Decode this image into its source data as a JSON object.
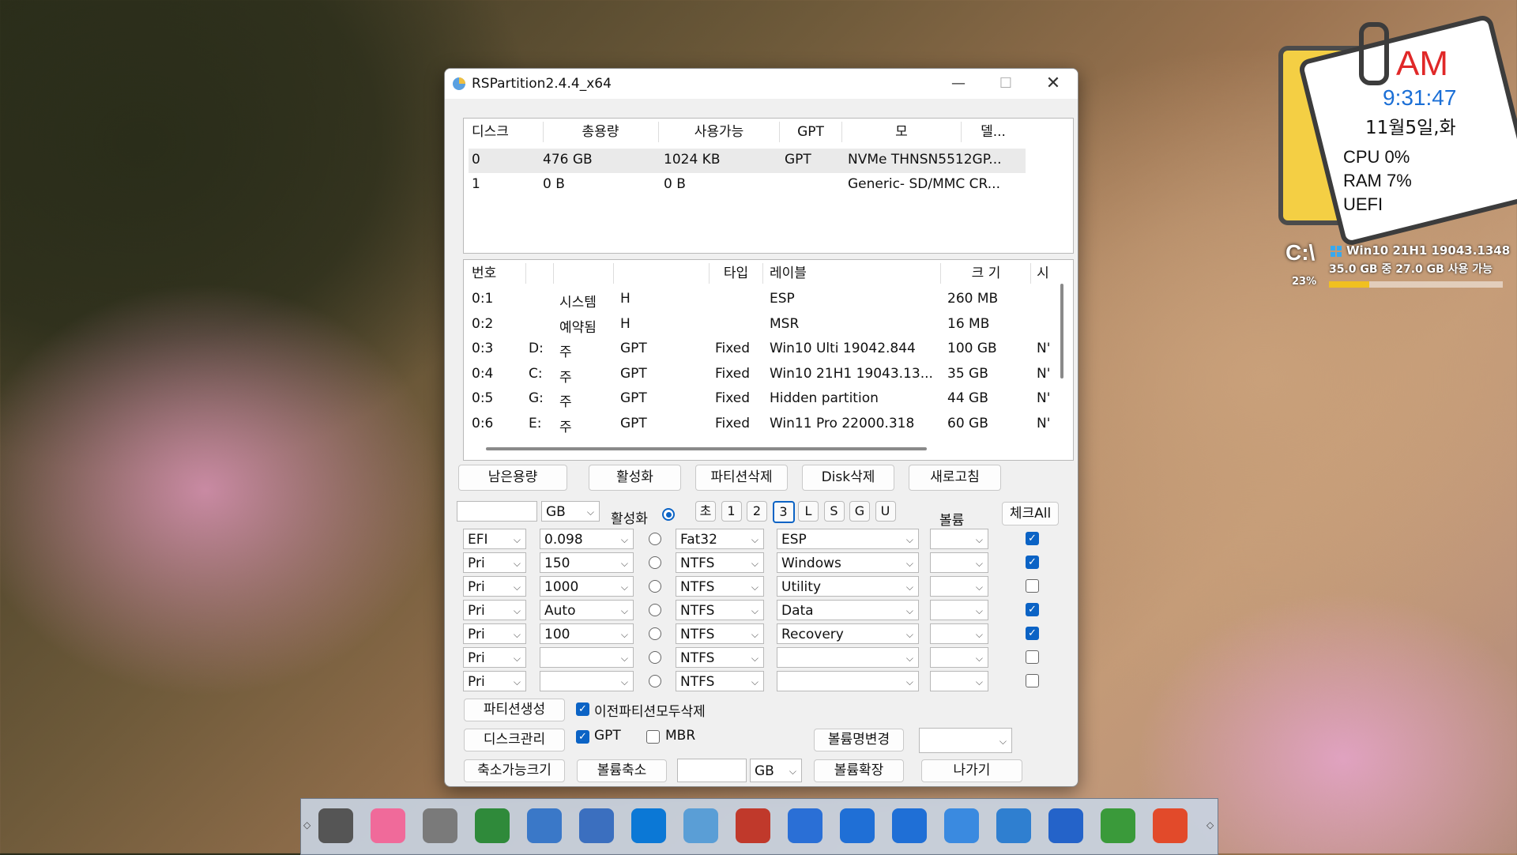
{
  "window": {
    "title": "RSPartition2.4.4_x64",
    "min": "—",
    "max": "☐",
    "close": "✕"
  },
  "disks": {
    "headers": [
      "디스크",
      "총용량",
      "사용가능",
      "GPT",
      "모",
      "델..."
    ],
    "rows": [
      [
        "0",
        "476 GB",
        "1024 KB",
        "GPT",
        "NVMe THNSN5512GP..."
      ],
      [
        "1",
        "0 B",
        "0 B",
        "",
        "Generic- SD/MMC CR..."
      ]
    ]
  },
  "partitions": {
    "headers": [
      "번호",
      "",
      "",
      "",
      "타입",
      "레이블",
      "크 기",
      "시"
    ],
    "rows": [
      [
        "0:1",
        "",
        "시스템",
        "H",
        "",
        "ESP",
        "260 MB",
        ""
      ],
      [
        "0:2",
        "",
        "예약됨",
        "H",
        "",
        "MSR",
        "16 MB",
        ""
      ],
      [
        "0:3",
        "D:",
        "주",
        "GPT",
        "Fixed",
        "Win10 Ulti 19042.844",
        "100 GB",
        "N'"
      ],
      [
        "0:4",
        "C:",
        "주",
        "GPT",
        "Fixed",
        "Win10 21H1 19043.13...",
        "35 GB",
        "N'"
      ],
      [
        "0:5",
        "G:",
        "주",
        "GPT",
        "Fixed",
        "Hidden partition",
        "44 GB",
        "N'"
      ],
      [
        "0:6",
        "E:",
        "주",
        "GPT",
        "Fixed",
        "Win11 Pro 22000.318",
        "60 GB",
        "N'"
      ]
    ]
  },
  "action_buttons": [
    "남은용량",
    "활성화",
    "파티션삭제",
    "Disk삭제",
    "새로고침"
  ],
  "form": {
    "size_value": "",
    "unit": "GB",
    "active_label": "활성화",
    "pills": [
      "초",
      "1",
      "2",
      "3",
      "L",
      "S",
      "G",
      "U"
    ],
    "selected_pill": "3",
    "volume_label": "볼륨",
    "check_all": "체크All",
    "rows": [
      {
        "type": "EFI",
        "size": "0.098",
        "fs": "Fat32",
        "label": "ESP",
        "checked": true
      },
      {
        "type": "Pri",
        "size": "150",
        "fs": "NTFS",
        "label": "Windows",
        "checked": true
      },
      {
        "type": "Pri",
        "size": "1000",
        "fs": "NTFS",
        "label": "Utility",
        "checked": false
      },
      {
        "type": "Pri",
        "size": "Auto",
        "fs": "NTFS",
        "label": "Data",
        "checked": true
      },
      {
        "type": "Pri",
        "size": "100",
        "fs": "NTFS",
        "label": "Recovery",
        "checked": true
      },
      {
        "type": "Pri",
        "size": "",
        "fs": "NTFS",
        "label": "",
        "checked": false
      },
      {
        "type": "Pri",
        "size": "",
        "fs": "NTFS",
        "label": "",
        "checked": false
      }
    ]
  },
  "bottom": {
    "create": "파티션생성",
    "delete_all": "이전파티션모두삭제",
    "disk_mgmt": "디스크관리",
    "gpt": "GPT",
    "mbr": "MBR",
    "rename_volume": "볼륨명변경",
    "shrinkable": "축소가능크기",
    "shrink": "볼륨축소",
    "shrink_unit": "GB",
    "extend": "볼륨확장",
    "exit": "나가기"
  },
  "widget": {
    "ampm": "AM",
    "time": "9:31:47",
    "date": "11월5일,화",
    "cpu": "CPU  0%",
    "ram": "RAM  7%",
    "boot": "UEFI",
    "drive": "C:\\",
    "drive_pct": "23%",
    "drive_name": "Win10 21H1 19043.1348",
    "drive_free": "35.0 GB 중  27.0 GB 사용 가능",
    "drive_used_fraction": 0.23
  },
  "taskbar": {
    "icons": [
      "disk-tool-icon",
      "windows-pink-icon",
      "drive-tool-icon",
      "partition-icon",
      "search-tool-icon",
      "grid-icon",
      "windows-blue-icon",
      "file-icon",
      "toolbox-icon",
      "media-gear-icon",
      "windows-7-icon",
      "windows-7-alt-icon",
      "camera-icon",
      "explorer-icon",
      "windows-xp-icon",
      "update-icon",
      "power-icon"
    ],
    "colors": [
      "#555555",
      "#f06a9a",
      "#7a7a7a",
      "#2f8a3a",
      "#3a78c8",
      "#3b6fbf",
      "#0b78d6",
      "#5a9ed6",
      "#c0392b",
      "#2a6fd6",
      "#1f6fd6",
      "#1f6fd6",
      "#3a8ae0",
      "#2f7fd0",
      "#2463c9",
      "#3a9a3a",
      "#e24a2a"
    ]
  }
}
